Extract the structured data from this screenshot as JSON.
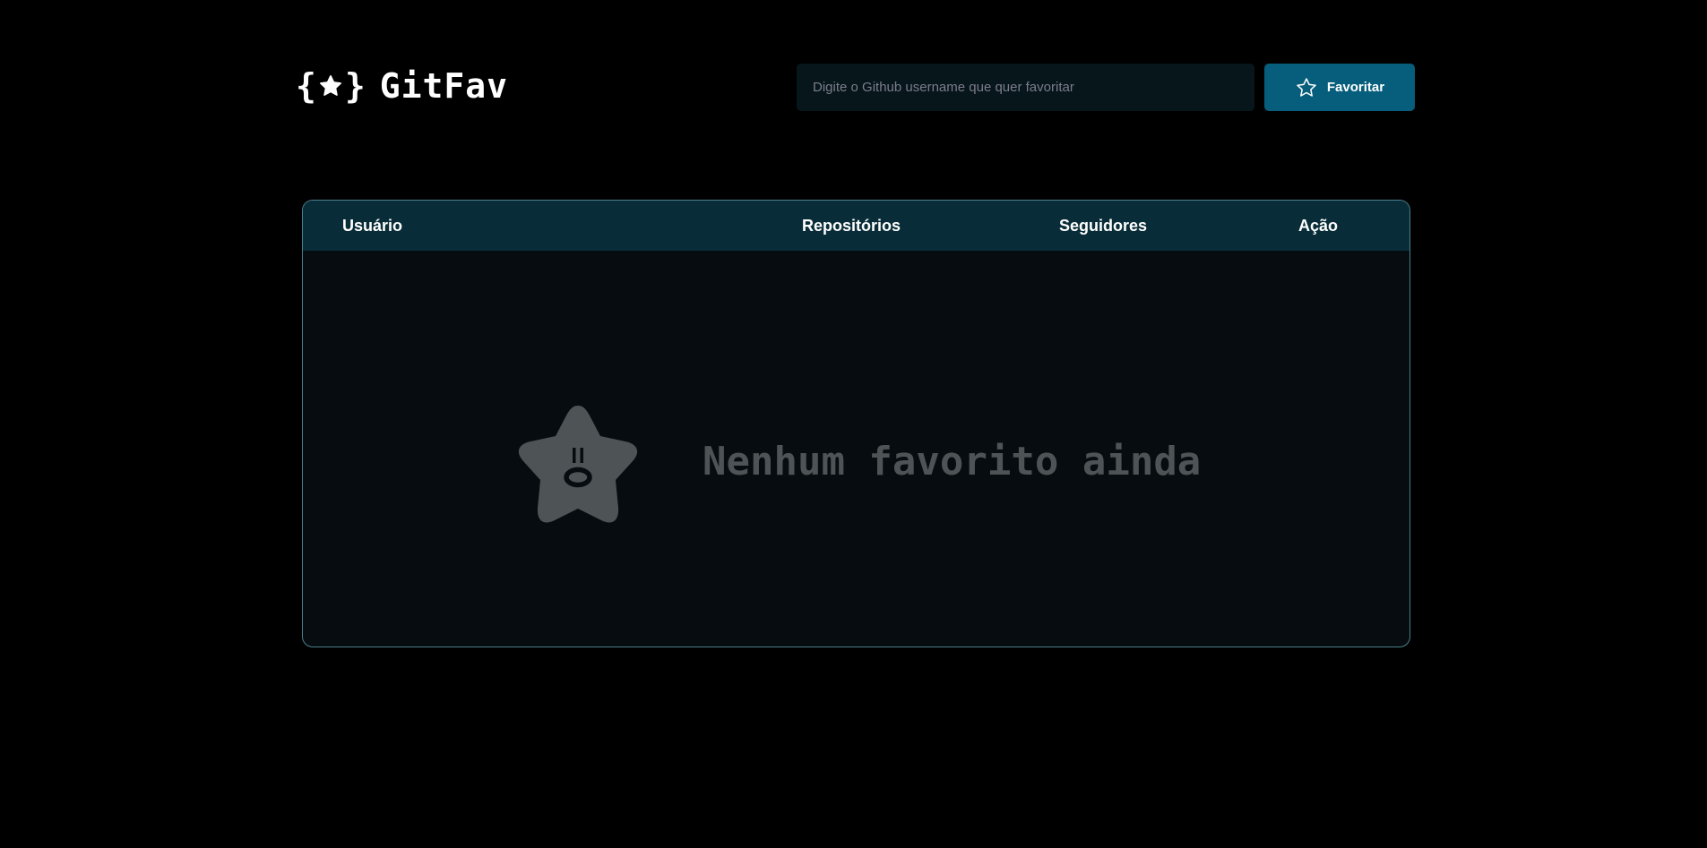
{
  "brand": {
    "name": "GitFav",
    "logo_left_brace": "{",
    "logo_right_brace": "}",
    "logo_icon": "star-icon"
  },
  "search": {
    "placeholder": "Digite o Github username que quer favoritar",
    "value": ""
  },
  "favorite_button": {
    "label": "Favoritar",
    "icon": "star-outline-icon"
  },
  "table": {
    "columns": [
      "Usuário",
      "Repositórios",
      "Seguidores",
      "Ação"
    ],
    "rows": [],
    "empty_state": {
      "icon": "sad-star-icon",
      "message": "Nenhum favorito ainda"
    }
  },
  "colors": {
    "background": "#000000",
    "accent": "#065e7c",
    "table_header": "#092d38",
    "table_body": "#060c0f",
    "table_border": "#4a808c",
    "input_background": "#06161b",
    "muted_text": "#4e5455"
  }
}
